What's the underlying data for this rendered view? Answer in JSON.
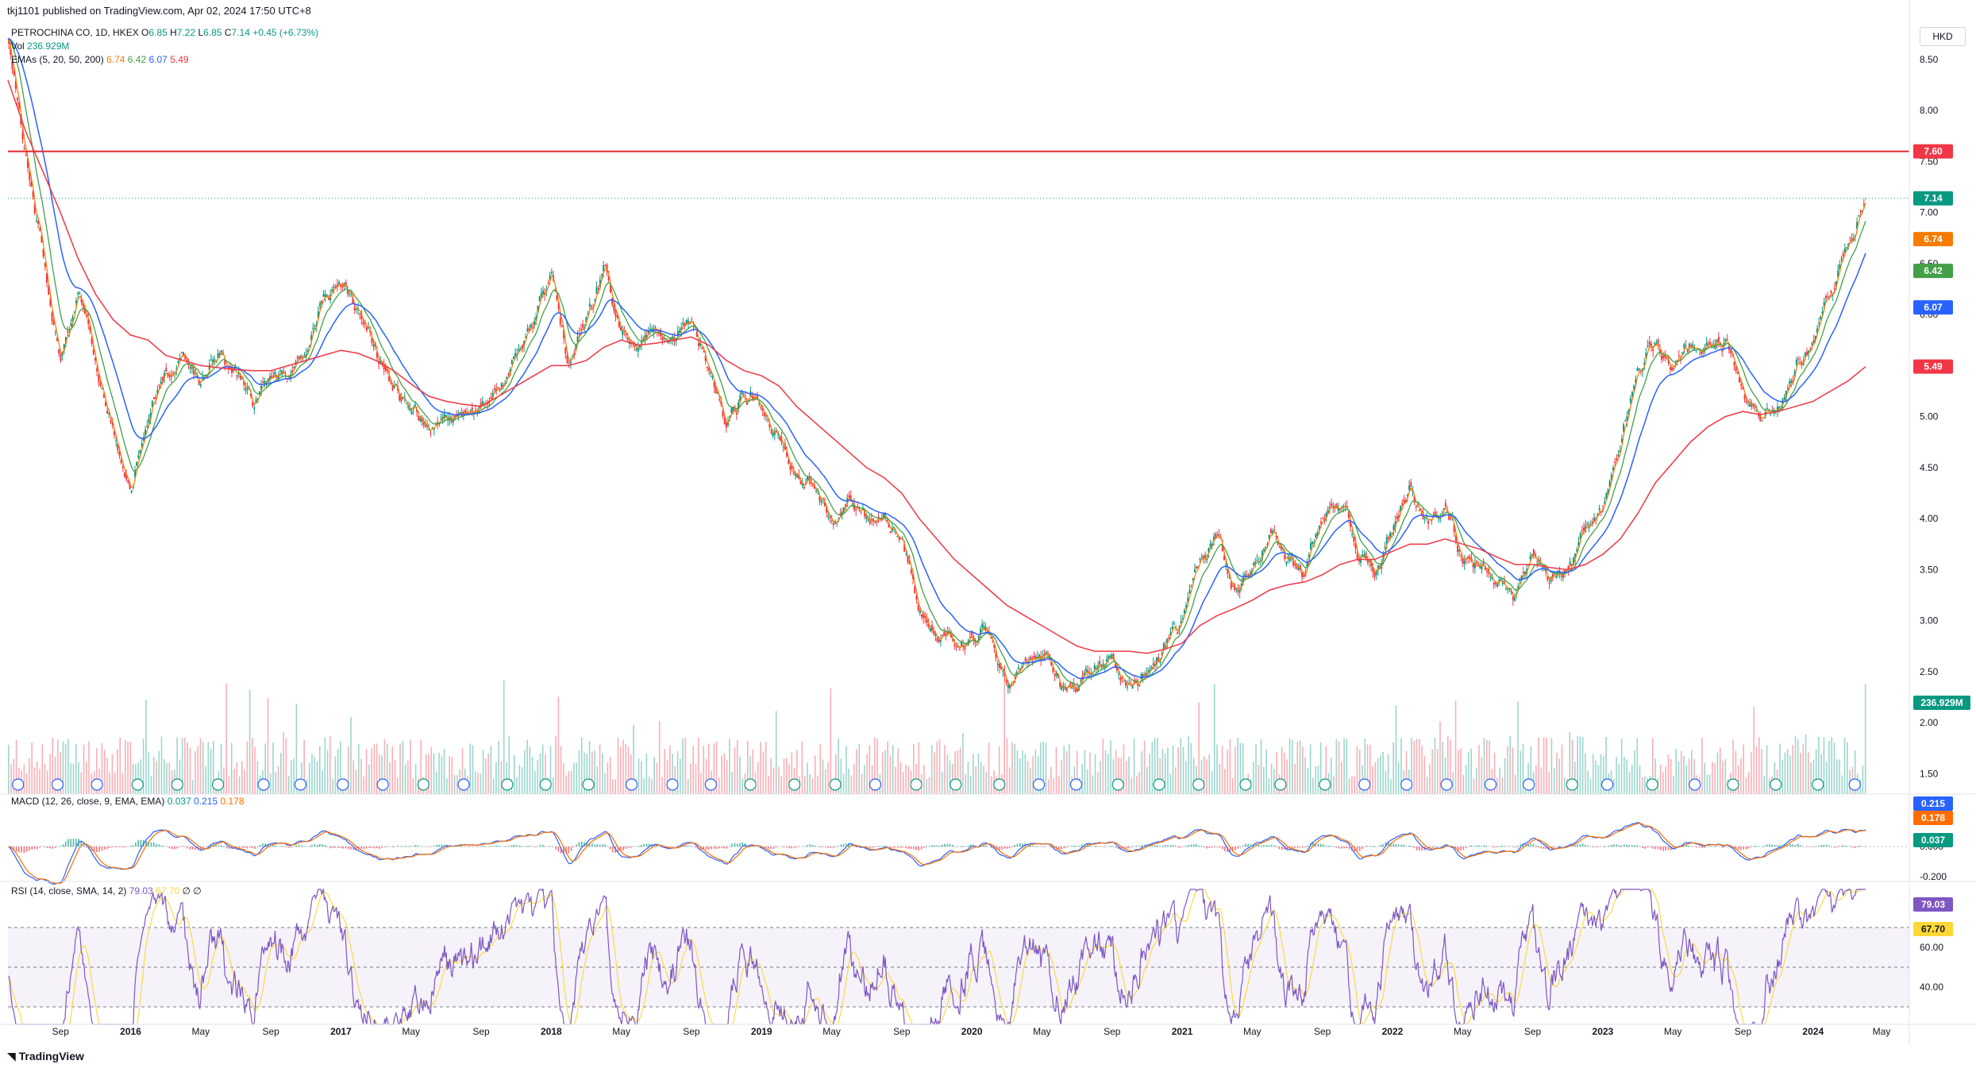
{
  "publisher": "tkj1101 published on TradingView.com, Apr 02, 2024 17:50 UTC+8",
  "currency": "HKD",
  "legend": {
    "symbol": "PETROCHINA CO, 1D, HKEX",
    "ohlc": {
      "o_label": "O",
      "o": "6.85",
      "h_label": "H",
      "h": "7.22",
      "l_label": "L",
      "l": "6.85",
      "c_label": "C",
      "c": "7.14",
      "change": "+0.45 (+6.73%)"
    },
    "vol_label": "Vol",
    "vol_value": "236.929M",
    "emas_label": "EMAs (5, 20, 50, 200)",
    "ema_values": [
      "6.74",
      "6.42",
      "6.07",
      "5.49"
    ]
  },
  "macd_legend": {
    "label": "MACD (12, 26, close, 9, EMA, EMA)",
    "values": [
      "0.037",
      "0.215",
      "0.178"
    ]
  },
  "rsi_legend": {
    "label": "RSI (14, close, SMA, 14, 2)",
    "values": [
      "79.03",
      "67.70"
    ],
    "extra": "∅ ∅"
  },
  "price_badges": [
    {
      "text": "7.60",
      "color": "#f23645",
      "value": 7.6
    },
    {
      "text": "7.14",
      "color": "#089981",
      "value": 7.14
    },
    {
      "text": "6.74",
      "color": "#f57c00",
      "value": 6.74
    },
    {
      "text": "6.42",
      "color": "#43a047",
      "value": 6.42
    },
    {
      "text": "6.07",
      "color": "#2962ff",
      "value": 6.07
    },
    {
      "text": "5.49",
      "color": "#f23645",
      "value": 5.49
    }
  ],
  "volume_badge": {
    "text": "236.929M",
    "color": "#089981"
  },
  "macd_badges": [
    {
      "text": "0.215",
      "color": "#2962ff"
    },
    {
      "text": "0.178",
      "color": "#ff6d00"
    },
    {
      "text": "0.037",
      "color": "#089981"
    }
  ],
  "rsi_badges": [
    {
      "text": "79.03",
      "color": "#7e57c2"
    },
    {
      "text": "67.70",
      "color": "#fdd835"
    }
  ],
  "tv_logo": "TradingView",
  "colors": {
    "up": "#089981",
    "down": "#f23645",
    "ema5": "#f57c00",
    "ema20": "#43a047",
    "ema50": "#2962ff",
    "ema200": "#f23645",
    "macd": "#2962ff",
    "signal": "#ff6d00",
    "rsi": "#7e57c2",
    "rsi_ma": "#fdd835",
    "resistance": "#e0262e"
  },
  "chart_data": {
    "type": "candlestick",
    "symbol": "PETROCHINA CO",
    "interval": "1D",
    "exchange": "HKEX",
    "price_axis": {
      "ticks": [
        "8.50",
        "8.00",
        "7.50",
        "7.00",
        "6.50",
        "6.00",
        "5.50",
        "5.00",
        "4.50",
        "4.00",
        "3.50",
        "3.00",
        "2.50",
        "2.00",
        "1.50"
      ],
      "ylim": [
        1.3,
        8.85
      ]
    },
    "time_axis": [
      "Sep",
      "2016",
      "May",
      "Sep",
      "2017",
      "May",
      "Sep",
      "2018",
      "May",
      "Sep",
      "2019",
      "May",
      "Sep",
      "2020",
      "May",
      "Sep",
      "2021",
      "May",
      "Sep",
      "2022",
      "May",
      "Sep",
      "2023",
      "May",
      "Sep",
      "2024",
      "May"
    ],
    "horizontal_line": 7.6,
    "last_close": 7.14,
    "close_series": {
      "t": [
        "2015-06",
        "2015-07",
        "2015-08",
        "2015-09",
        "2015-10",
        "2015-11",
        "2015-12",
        "2016-01",
        "2016-02",
        "2016-03",
        "2016-04",
        "2016-05",
        "2016-06",
        "2016-07",
        "2016-08",
        "2016-09",
        "2016-10",
        "2016-11",
        "2016-12",
        "2017-01",
        "2017-02",
        "2017-03",
        "2017-04",
        "2017-05",
        "2017-06",
        "2017-07",
        "2017-08",
        "2017-09",
        "2017-10",
        "2017-11",
        "2017-12",
        "2018-01",
        "2018-02",
        "2018-03",
        "2018-04",
        "2018-05",
        "2018-06",
        "2018-07",
        "2018-08",
        "2018-09",
        "2018-10",
        "2018-11",
        "2018-12",
        "2019-01",
        "2019-02",
        "2019-03",
        "2019-04",
        "2019-05",
        "2019-06",
        "2019-07",
        "2019-08",
        "2019-09",
        "2019-10",
        "2019-11",
        "2019-12",
        "2020-01",
        "2020-02",
        "2020-03",
        "2020-04",
        "2020-05",
        "2020-06",
        "2020-07",
        "2020-08",
        "2020-09",
        "2020-10",
        "2020-11",
        "2020-12",
        "2021-01",
        "2021-02",
        "2021-03",
        "2021-04",
        "2021-05",
        "2021-06",
        "2021-07",
        "2021-08",
        "2021-09",
        "2021-10",
        "2021-11",
        "2021-12",
        "2022-01",
        "2022-02",
        "2022-03",
        "2022-04",
        "2022-05",
        "2022-06",
        "2022-07",
        "2022-08",
        "2022-09",
        "2022-10",
        "2022-11",
        "2022-12",
        "2023-01",
        "2023-02",
        "2023-03",
        "2023-04",
        "2023-05",
        "2023-06",
        "2023-07",
        "2023-08",
        "2023-09",
        "2023-10",
        "2023-11",
        "2023-12",
        "2024-01",
        "2024-02",
        "2024-03",
        "2024-04"
      ],
      "close": [
        8.75,
        7.6,
        6.6,
        5.55,
        6.25,
        5.5,
        4.9,
        4.3,
        5.05,
        5.35,
        5.6,
        5.35,
        5.6,
        5.4,
        5.1,
        5.45,
        5.5,
        5.6,
        6.15,
        6.3,
        6.0,
        5.7,
        5.3,
        5.0,
        4.9,
        4.95,
        5.0,
        5.05,
        5.35,
        5.6,
        5.9,
        6.35,
        5.5,
        5.9,
        6.5,
        5.9,
        5.75,
        5.9,
        5.8,
        5.9,
        5.5,
        4.9,
        5.25,
        5.2,
        4.85,
        4.55,
        4.35,
        4.0,
        4.2,
        3.95,
        4.15,
        3.75,
        3.2,
        2.85,
        2.85,
        2.85,
        2.85,
        2.3,
        2.55,
        2.6,
        2.45,
        2.35,
        2.55,
        2.6,
        2.4,
        2.5,
        2.75,
        2.95,
        3.55,
        3.75,
        3.3,
        3.5,
        3.9,
        3.6,
        3.45,
        4.0,
        4.15,
        3.65,
        3.45,
        3.9,
        4.3,
        3.9,
        4.15,
        3.6,
        3.6,
        3.35,
        3.15,
        3.6,
        3.45,
        3.5,
        3.9,
        4.15,
        4.65,
        5.5,
        5.75,
        5.55,
        5.75,
        5.6,
        5.7,
        5.15,
        4.9,
        5.1,
        5.5,
        5.7,
        6.2,
        6.6,
        7.14
      ]
    },
    "ema_series": {
      "ema200": [
        8.3,
        7.8,
        7.4,
        7.0,
        6.55,
        6.2,
        5.95,
        5.8,
        5.75,
        5.6,
        5.55,
        5.5,
        5.48,
        5.46,
        5.45,
        5.45,
        5.5,
        5.55,
        5.6,
        5.65,
        5.62,
        5.55,
        5.45,
        5.32,
        5.2,
        5.15,
        5.12,
        5.1,
        5.2,
        5.3,
        5.4,
        5.5,
        5.5,
        5.55,
        5.68,
        5.75,
        5.7,
        5.72,
        5.75,
        5.78,
        5.7,
        5.55,
        5.45,
        5.4,
        5.3,
        5.1,
        4.95,
        4.8,
        4.65,
        4.5,
        4.4,
        4.25,
        4.0,
        3.8,
        3.6,
        3.45,
        3.3,
        3.15,
        3.05,
        2.95,
        2.85,
        2.75,
        2.7,
        2.7,
        2.7,
        2.68,
        2.72,
        2.78,
        2.95,
        3.05,
        3.12,
        3.2,
        3.3,
        3.35,
        3.38,
        3.45,
        3.55,
        3.6,
        3.6,
        3.68,
        3.75,
        3.75,
        3.8,
        3.75,
        3.7,
        3.62,
        3.55,
        3.55,
        3.52,
        3.5,
        3.55,
        3.65,
        3.8,
        4.05,
        4.35,
        4.55,
        4.75,
        4.9,
        5.0,
        5.05,
        5.02,
        5.05,
        5.1,
        5.15,
        5.25,
        5.35,
        5.49
      ]
    },
    "volume": {
      "last": "236.929M"
    },
    "macd": {
      "macd": 0.215,
      "signal": 0.178,
      "histogram": 0.037,
      "axis_ticks": [
        "0.000",
        "-0.200"
      ]
    },
    "rsi": {
      "rsi": 79.03,
      "ma": 67.7,
      "axis_ticks": [
        "60.00",
        "40.00"
      ],
      "bands": [
        70,
        30
      ]
    }
  }
}
